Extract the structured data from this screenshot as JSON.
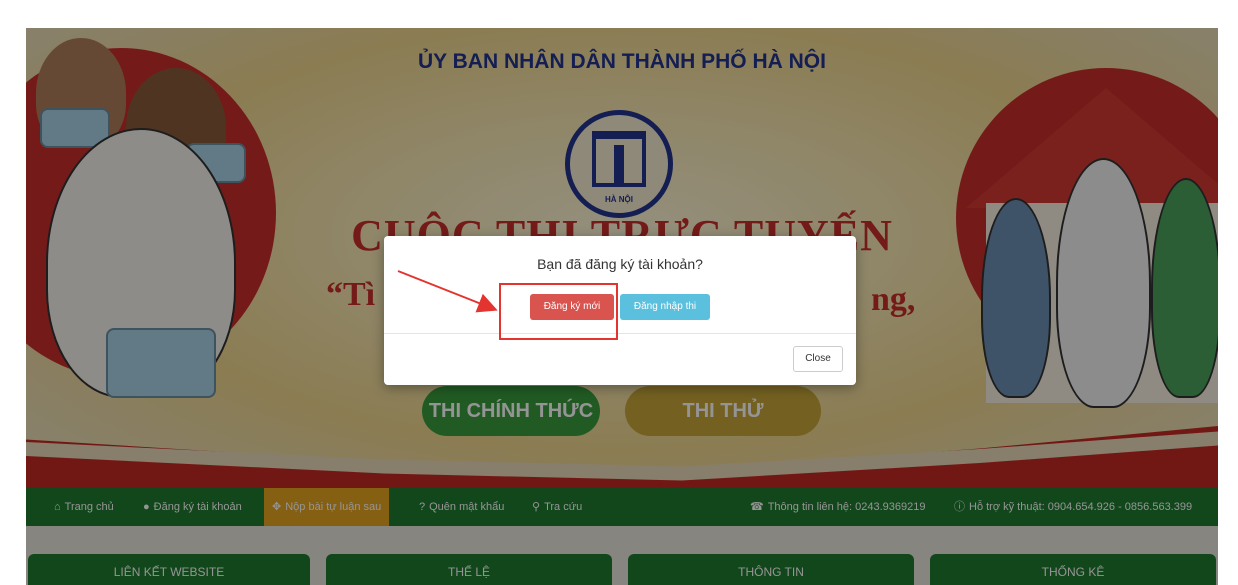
{
  "banner": {
    "org_title": "ỦY BAN NHÂN DÂN THÀNH PHỐ HÀ NỘI",
    "emblem_text": "HÀ NỘI",
    "contest_title": "CUỘC THI TRỰC TUYẾN",
    "slogan_left": "“Tì",
    "slogan_right": "ng,",
    "official_button": "THI CHÍNH THỨC",
    "trial_button": "THI THỬ"
  },
  "nav": {
    "home": "Trang chủ",
    "register": "Đăng ký tài khoản",
    "submit_essay": "Nộp bài tự luận sau",
    "forgot_password": "Quên mật khẩu",
    "lookup": "Tra cứu",
    "contact": "Thông tin liên hệ: 0243.9369219",
    "support": "Hỗ trợ kỹ thuật: 0904.654.926 - 0856.563.399"
  },
  "boxes": [
    "LIÊN KẾT WEBSITE",
    "THỂ LỆ",
    "THÔNG TIN",
    "THỐNG KÊ"
  ],
  "modal": {
    "question": "Bạn đã đăng ký tài khoản?",
    "register_new": "Đăng ký mới",
    "login": "Đăng nhập thi",
    "close": "Close"
  },
  "colors": {
    "accent_red": "#d9534f",
    "accent_blue": "#5bc0de",
    "nav_green": "#1f7a2f",
    "nav_active": "#e6a522",
    "annotation_red": "#e3342f"
  }
}
